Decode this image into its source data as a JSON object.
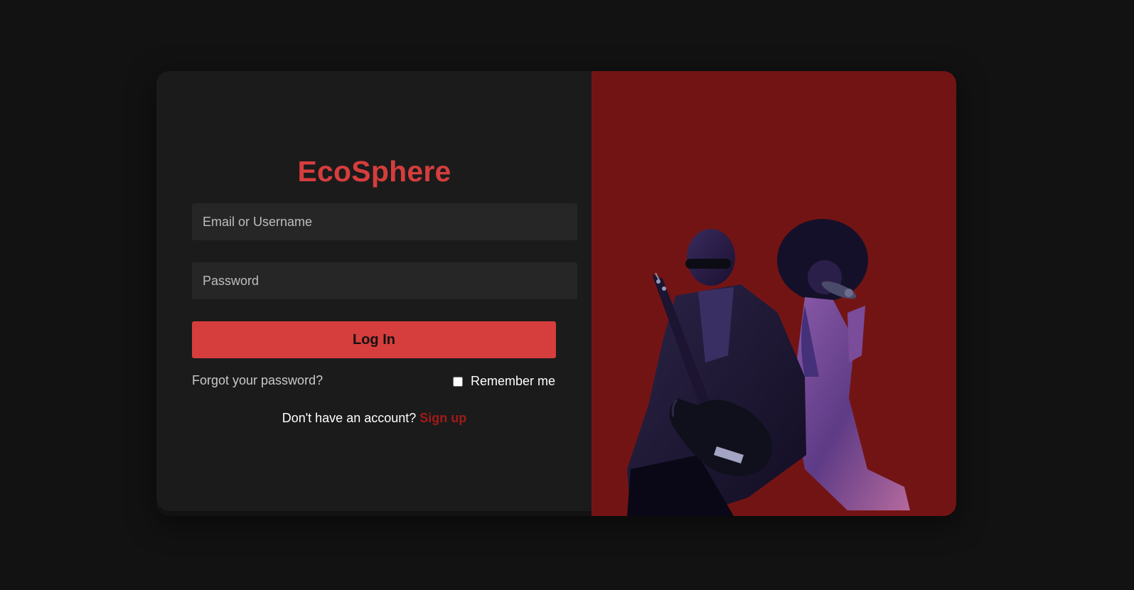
{
  "brand": {
    "title": "EcoSphere"
  },
  "form": {
    "email_placeholder": "Email or Username",
    "password_placeholder": "Password",
    "login_label": "Log In",
    "forgot_label": "Forgot your password?",
    "remember_label": "Remember me",
    "signup_prompt": "Don't have an account?",
    "signup_link": "Sign up"
  },
  "colors": {
    "background": "#121212",
    "panel": "#1b1b1b",
    "accent": "#d63d3d",
    "image_panel": "#731414"
  },
  "image": {
    "description_name": "musicians-photo"
  }
}
